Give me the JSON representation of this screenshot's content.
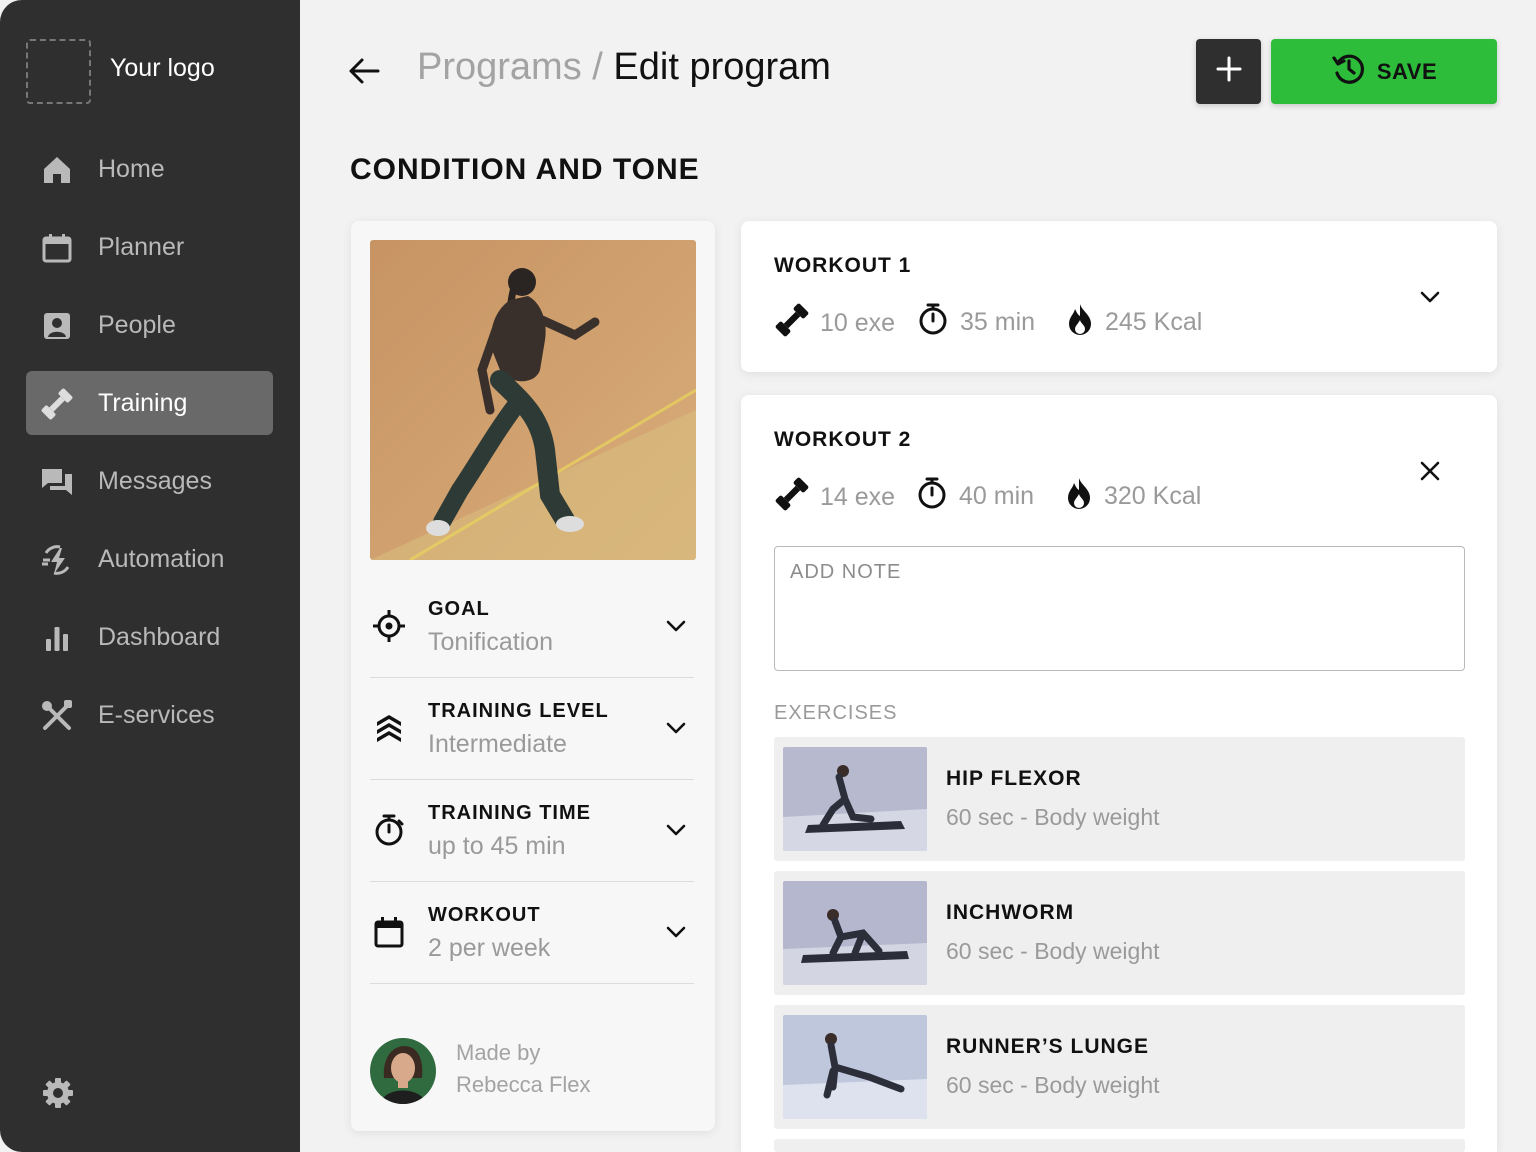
{
  "sidebar": {
    "logo_text": "Your logo",
    "items": [
      {
        "label": "Home",
        "icon": "home-icon",
        "active": false
      },
      {
        "label": "Planner",
        "icon": "calendar-icon",
        "active": false
      },
      {
        "label": "People",
        "icon": "person-card-icon",
        "active": false
      },
      {
        "label": "Training",
        "icon": "dumbbell-icon",
        "active": true
      },
      {
        "label": "Messages",
        "icon": "chat-icon",
        "active": false
      },
      {
        "label": "Automation",
        "icon": "automation-icon",
        "active": false
      },
      {
        "label": "Dashboard",
        "icon": "bar-chart-icon",
        "active": false
      },
      {
        "label": "E-services",
        "icon": "tools-icon",
        "active": false
      }
    ],
    "settings_icon": "gear-icon"
  },
  "header": {
    "breadcrumb_parent": "Programs",
    "breadcrumb_separator": " / ",
    "breadcrumb_current": "Edit program",
    "add_icon": "plus-icon",
    "save_label": "SAVE",
    "save_icon": "history-icon"
  },
  "program": {
    "title": "CONDITION AND TONE",
    "details": [
      {
        "label": "GOAL",
        "value": "Tonification",
        "icon": "target-icon"
      },
      {
        "label": "TRAINING LEVEL",
        "value": "Intermediate",
        "icon": "level-chevrons-icon"
      },
      {
        "label": "TRAINING TIME",
        "value": "up to 45 min",
        "icon": "stopwatch-icon"
      },
      {
        "label": "WORKOUT",
        "value": "2 per week",
        "icon": "calendar-icon"
      }
    ],
    "author_caption": "Made by",
    "author_name": "Rebecca Flex"
  },
  "workouts": [
    {
      "title": "WORKOUT 1",
      "exercises": "10 exe",
      "duration": "35 min",
      "calories": "245 Kcal",
      "expanded": false
    },
    {
      "title": "WORKOUT 2",
      "exercises": "14 exe",
      "duration": "40 min",
      "calories": "320 Kcal",
      "expanded": true,
      "note_placeholder": "ADD NOTE",
      "exercises_label": "EXERCISES",
      "exercise_list": [
        {
          "name": "HIP FLEXOR",
          "meta": "60 sec - Body weight"
        },
        {
          "name": "INCHWORM",
          "meta": "60 sec - Body weight"
        },
        {
          "name": "RUNNER’S LUNGE",
          "meta": "60 sec - Body weight"
        }
      ]
    }
  ],
  "colors": {
    "sidebar_bg": "#2f2f2f",
    "active_nav_bg": "#696969",
    "save_green": "#2dbd3a",
    "page_bg": "#f2f2f2"
  }
}
